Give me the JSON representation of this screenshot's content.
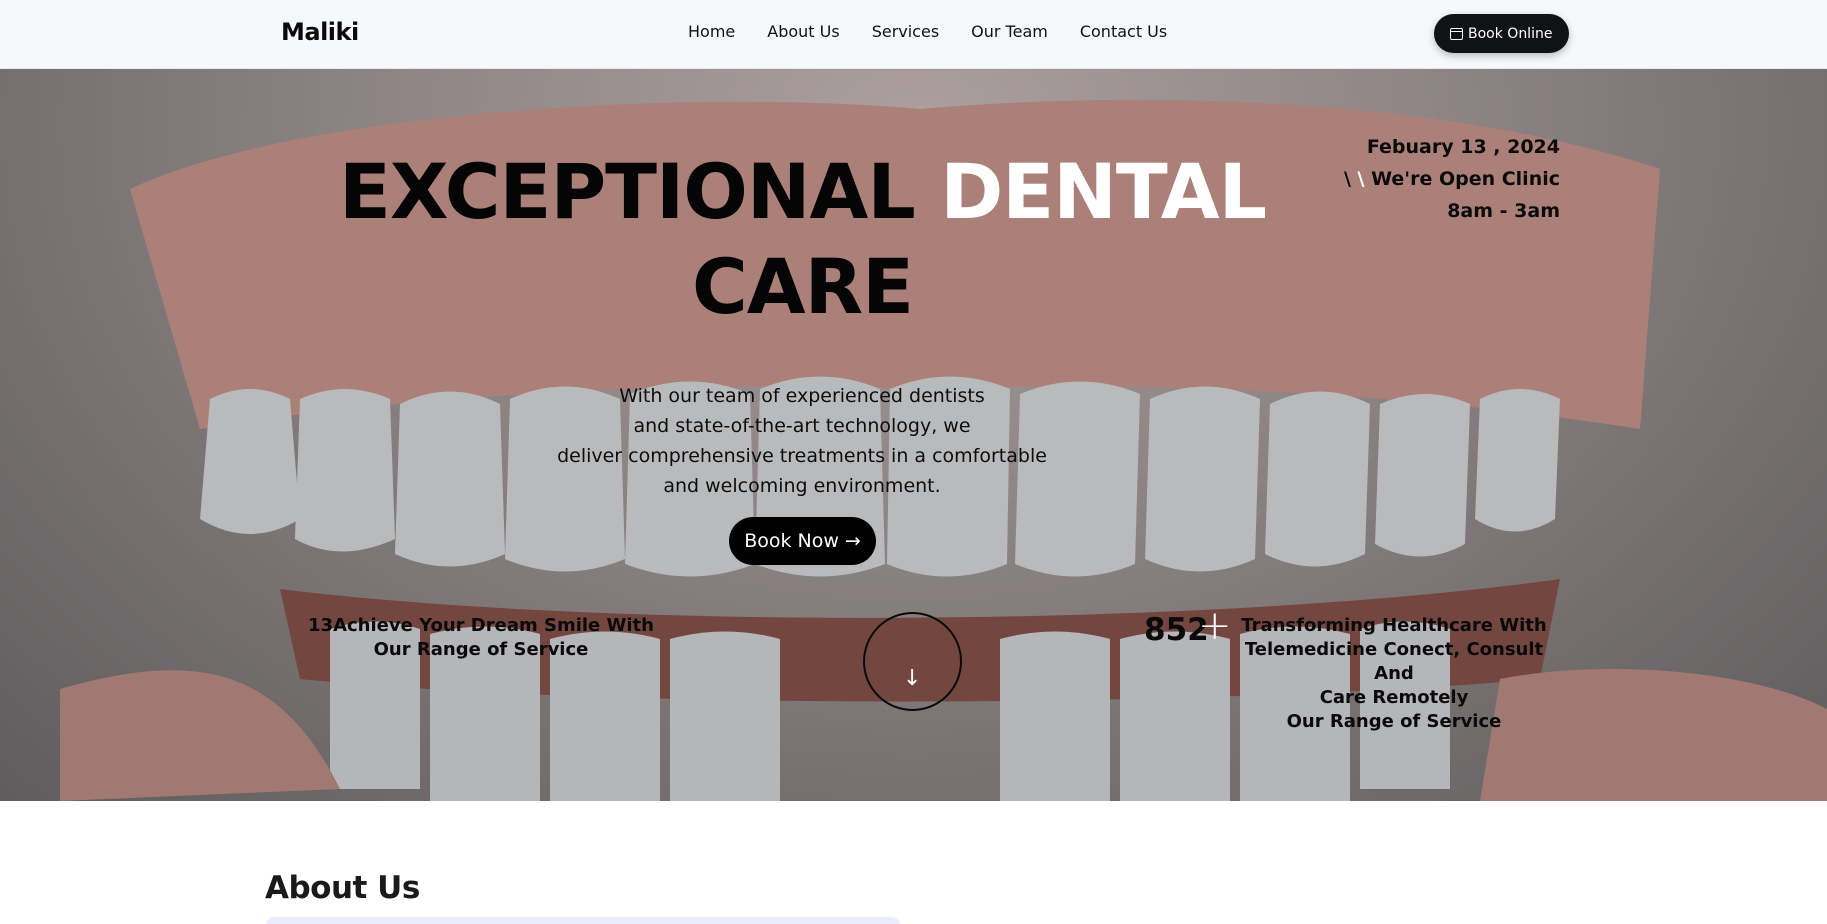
{
  "brand": "Maliki",
  "nav": {
    "items": [
      "Home",
      "About Us",
      "Services",
      "Our Team",
      "Contact Us"
    ],
    "book_online": "Book Online"
  },
  "hero": {
    "title_dark": "EXCEPTIONAL",
    "title_light": "DENTAL",
    "title_line2": "CARE",
    "info": {
      "date": "Febuary 13 , 2024",
      "slash_dark": "\\",
      "slash_light": "\\",
      "open_text": "We're Open Clinic",
      "hours": "8am - 3am"
    },
    "description": [
      "With our team of experienced dentists",
      "and state-of-the-art technology, we",
      "deliver comprehensive treatments in a comfortable",
      "and welcoming environment."
    ],
    "book_now": "Book Now",
    "stat_left": {
      "line1": "13Achieve Your Dream Smile With",
      "line2": "Our Range of Service"
    },
    "stat_right": {
      "number": "852",
      "plus": "+",
      "lines": [
        "Transforming Healthcare With",
        "Telemedicine Conect, Consult And",
        "Care Remotely",
        "Our Range of Service"
      ]
    },
    "scroll_icon": "arrow-down-icon"
  },
  "about": {
    "title": "About Us"
  },
  "colors": {
    "nav_bg": "#f6f8fc",
    "button_dark": "#111215",
    "accent_white": "#ffffff",
    "about_card": "#ecebfb"
  }
}
